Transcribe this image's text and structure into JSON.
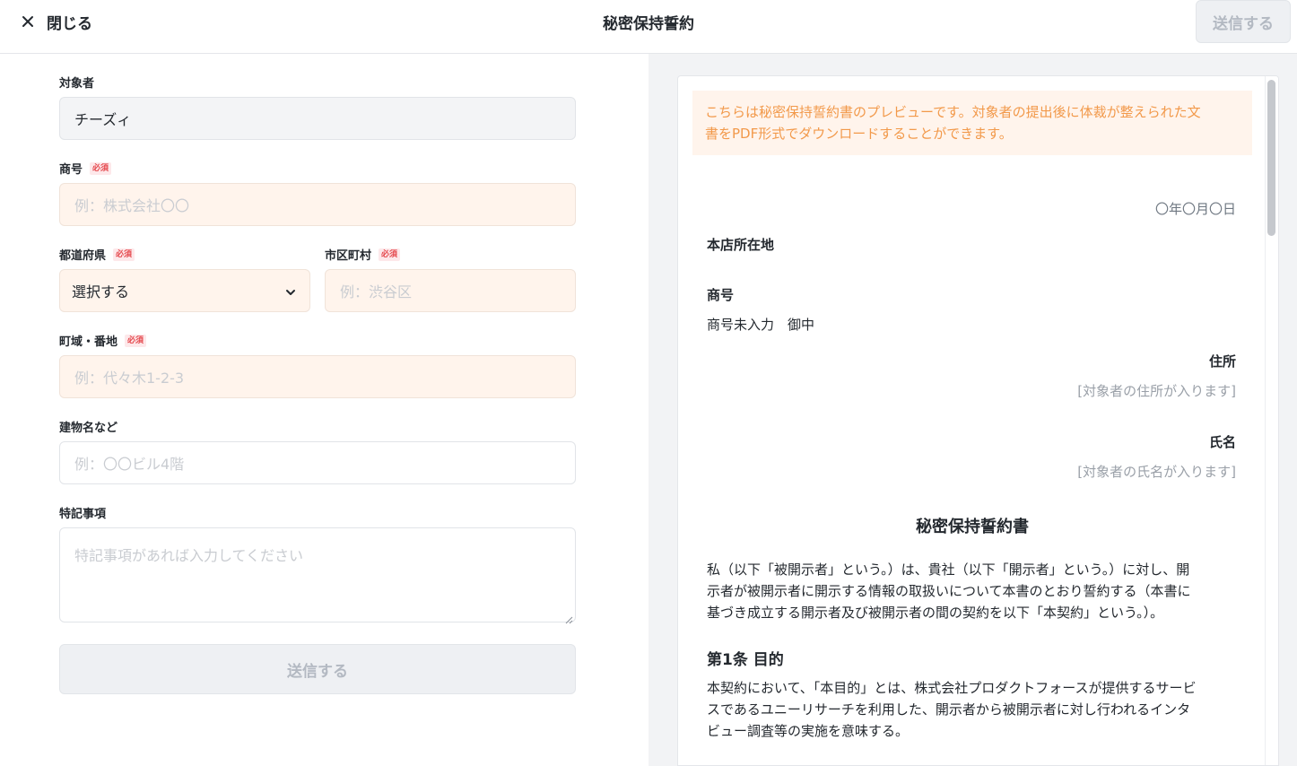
{
  "header": {
    "close_label": "閉じる",
    "title": "秘密保持誓約",
    "send_label": "送信する"
  },
  "form": {
    "target": {
      "label": "対象者",
      "value": "チーズィ"
    },
    "trade_name": {
      "label": "商号",
      "required": "必須",
      "placeholder": "例：株式会社〇〇"
    },
    "prefecture": {
      "label": "都道府県",
      "required": "必須",
      "value": "選択する"
    },
    "city": {
      "label": "市区町村",
      "required": "必須",
      "placeholder": "例：渋谷区"
    },
    "street": {
      "label": "町域・番地",
      "required": "必須",
      "placeholder": "例：代々木1-2-3"
    },
    "building": {
      "label": "建物名など",
      "placeholder": "例：〇〇ビル4階"
    },
    "notes": {
      "label": "特記事項",
      "placeholder": "特記事項があれば入力してください"
    },
    "submit_label": "送信する"
  },
  "preview": {
    "notice_line1": "こちらは秘密保持誓約書のプレビューです。対象者の提出後に体裁が整えられた文",
    "notice_line2": "書をPDF形式でダウンロードすることができます。",
    "date": "〇年〇月〇日",
    "hq_label": "本店所在地",
    "trade_label": "商号",
    "trade_value": "商号未入力　御中",
    "address_label": "住所",
    "address_value": "[対象者の住所が入ります]",
    "name_label": "氏名",
    "name_value": "[対象者の氏名が入ります]",
    "doc_title": "秘密保持誓約書",
    "intro_line1": "私（以下「被開示者」という。）は、貴社（以下「開示者」という。）に対し、開",
    "intro_line2": "示者が被開示者に開示する情報の取扱いについて本書のとおり誓約する（本書に",
    "intro_line3": "基づき成立する開示者及び被開示者の間の契約を以下「本契約」という。）。",
    "article1_title": "第1条 目的",
    "article1_line1": "本契約において、「本目的」とは、株式会社プロダクトフォースが提供するサービ",
    "article1_line2": "スであるユニーリサーチを利用した、開示者から被開示者に対し行われるインタ",
    "article1_line3": "ビュー調査等の実施を意味する。"
  },
  "colors": {
    "required_bg": "#fff4ec",
    "notice_text": "#f2994a",
    "required_badge": "#e5484d"
  }
}
